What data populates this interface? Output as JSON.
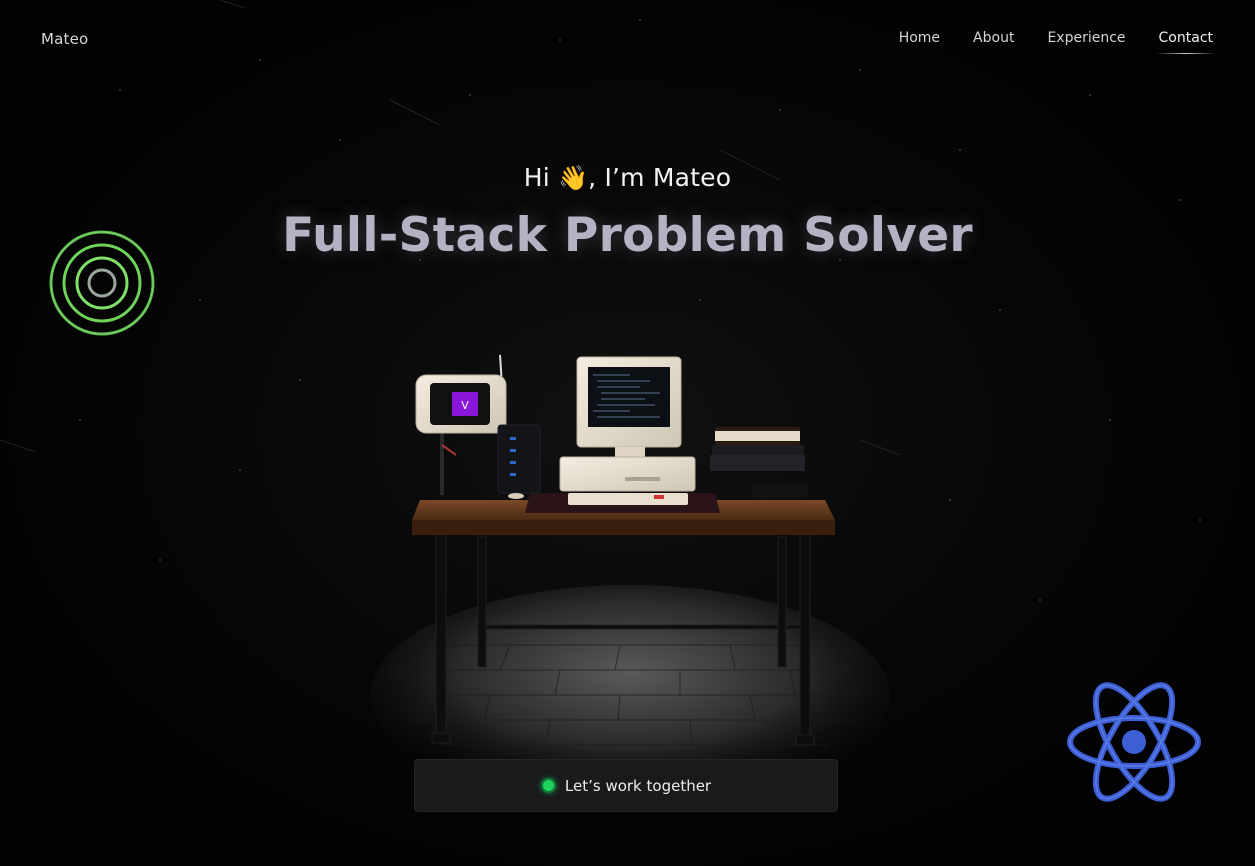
{
  "brand": {
    "name": "Mateo"
  },
  "nav": {
    "items": [
      {
        "label": "Home"
      },
      {
        "label": "About"
      },
      {
        "label": "Experience"
      },
      {
        "label": "Contact"
      }
    ],
    "active": "Contact"
  },
  "hero": {
    "greeting_prefix": "Hi",
    "wave_emoji": "👋",
    "greeting_suffix": ", I’m Mateo",
    "title": "Full-Stack Problem Solver"
  },
  "scene": {
    "tablet_letter": "V"
  },
  "cta": {
    "label": "Let’s work together",
    "status_color": "#1fd35f"
  },
  "icons": {
    "left_decor": "concentric-rings-icon",
    "right_decor": "react-atom-icon"
  },
  "colors": {
    "background": "#030303",
    "title": "#b5b3c3",
    "rings": "#6fd35a",
    "atom": "#3d5fd6",
    "tablet_screen": "#8a16d9"
  }
}
